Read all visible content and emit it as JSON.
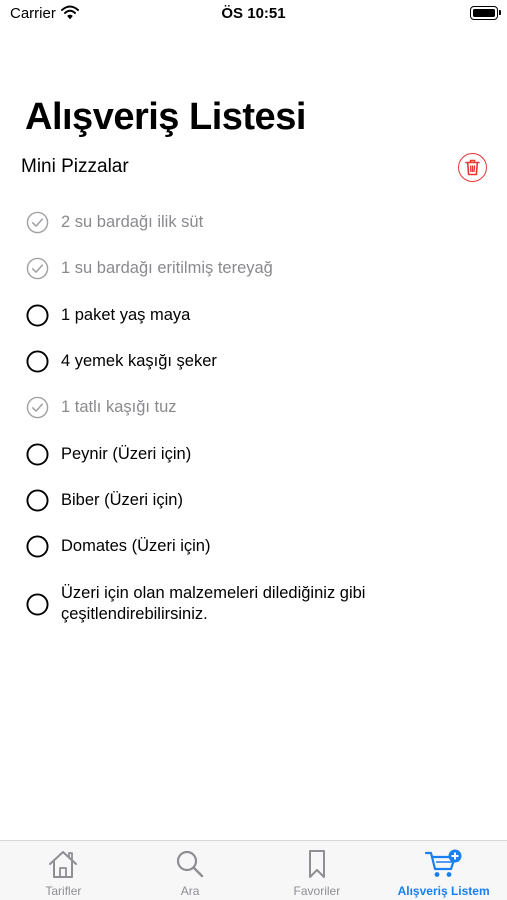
{
  "status_bar": {
    "carrier": "Carrier",
    "time": "ÖS 10:51"
  },
  "header": {
    "title": "Alışveriş Listesi",
    "recipe_name": "Mini Pizzalar"
  },
  "items": [
    {
      "label": "2 su bardağı ilik süt",
      "checked": true
    },
    {
      "label": "1 su bardağı eritilmiş tereyağ",
      "checked": true
    },
    {
      "label": "1 paket yaş maya",
      "checked": false
    },
    {
      "label": "4 yemek kaşığı şeker",
      "checked": false
    },
    {
      "label": "1 tatlı kaşığı tuz",
      "checked": true
    },
    {
      "label": "Peynir (Üzeri için)",
      "checked": false
    },
    {
      "label": "Biber (Üzeri için)",
      "checked": false
    },
    {
      "label": "Domates (Üzeri için)",
      "checked": false
    },
    {
      "label": "Üzeri için olan malzemeleri dilediğiniz gibi çeşitlendirebilirsiniz.",
      "checked": false
    }
  ],
  "tab_bar": {
    "tabs": [
      {
        "label": "Tarifler",
        "icon": "house-icon",
        "active": false
      },
      {
        "label": "Ara",
        "icon": "search-icon",
        "active": false
      },
      {
        "label": "Favoriler",
        "icon": "bookmark-icon",
        "active": false
      },
      {
        "label": "Alışveriş Listem",
        "icon": "cart-plus-icon",
        "active": true
      }
    ]
  },
  "colors": {
    "accent": "#1a7ff0",
    "delete": "#e53935",
    "checked_text": "#8a8a8e"
  }
}
